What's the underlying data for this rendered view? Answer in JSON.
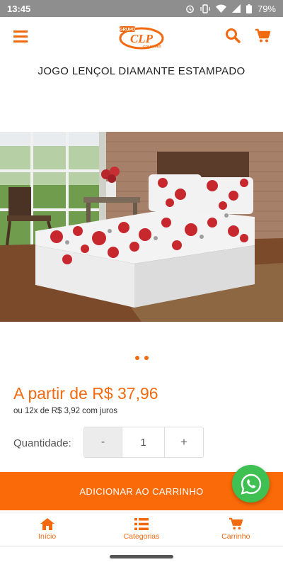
{
  "status_bar": {
    "time": "13:45",
    "battery": "79%",
    "icons": [
      "alarm-icon",
      "vibrate-icon",
      "wifi-icon",
      "signal-icon",
      "battery-icon"
    ]
  },
  "header": {
    "logo_text": "CLP",
    "logo_top_text": "GRUPO",
    "logo_bottom_text": "COLCHÕES",
    "icons": [
      "menu-icon",
      "search-icon",
      "cart-icon"
    ]
  },
  "product": {
    "title": "JOGO LENÇOL DIAMANTE ESTAMPADO",
    "price": "A partir de R$ 37,96",
    "installments": "ou 12x de R$ 3,92 com juros",
    "carousel_dots": 2
  },
  "quantity": {
    "label": "Quantidade:",
    "minus": "-",
    "value": "1",
    "plus": "+"
  },
  "actions": {
    "add_to_cart": "ADICIONAR AO CARRINHO"
  },
  "bottom_nav": [
    {
      "label": "Início",
      "icon": "home-icon"
    },
    {
      "label": "Categorias",
      "icon": "list-icon"
    },
    {
      "label": "Carrinho",
      "icon": "cart-icon"
    }
  ],
  "colors": {
    "accent": "#f26a10",
    "button": "#fb6a09",
    "whatsapp": "#3ec152",
    "status_bar": "#8e8e8e"
  }
}
